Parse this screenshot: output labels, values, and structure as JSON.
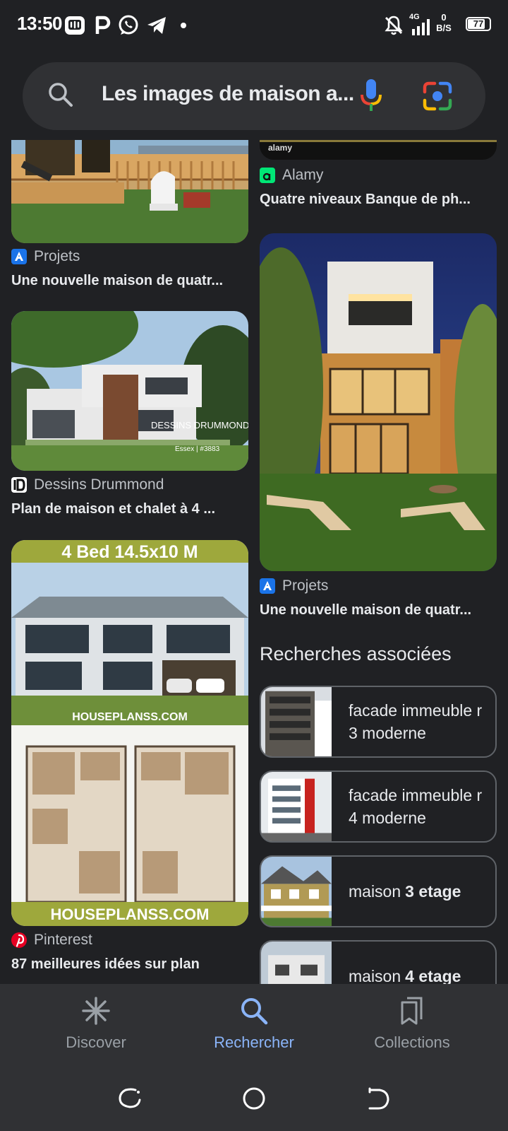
{
  "status_bar": {
    "time": "13:50",
    "network_label": "4G",
    "speed_value": "0",
    "speed_unit": "B/S",
    "battery": "77"
  },
  "search": {
    "query": "Les images de maison a..."
  },
  "results": {
    "left": [
      {
        "source": "Projets",
        "caption": "Une nouvelle maison de quatr..."
      },
      {
        "source": "Dessins Drummond",
        "caption": "Plan de maison et chalet à 4 ...",
        "image_text": "DESSINS DRUMMOND",
        "image_sub": "Essex | #3883"
      },
      {
        "source": "Pinterest",
        "caption": "87 meilleures idées sur plan",
        "image_header": "4 Bed 14.5x10 M",
        "image_watermark": "HOUSEPLANSS.COM",
        "image_footer": "HOUSEPLANSS.COM"
      }
    ],
    "right": [
      {
        "source": "Alamy",
        "caption": "Quatre niveaux Banque de ph...",
        "image_watermark": "alamy"
      },
      {
        "source": "Projets",
        "caption": "Une nouvelle maison de quatr..."
      }
    ]
  },
  "related": {
    "title": "Recherches associées",
    "items": [
      {
        "label": "facade immeuble r 3 moderne",
        "bold": ""
      },
      {
        "label": "facade immeuble r 4 moderne",
        "bold": ""
      },
      {
        "label": "maison",
        "bold": "3 etage"
      },
      {
        "label": "maison",
        "bold": "4 etage"
      }
    ]
  },
  "bottom_nav": {
    "items": [
      {
        "label": "Discover",
        "icon": "asterisk-icon"
      },
      {
        "label": "Rechercher",
        "icon": "search-icon",
        "active": true
      },
      {
        "label": "Collections",
        "icon": "bookmarks-icon"
      }
    ]
  },
  "colors": {
    "background": "#202124",
    "surface": "#303134",
    "accent": "#8ab4f8",
    "text": "#e8eaed"
  }
}
